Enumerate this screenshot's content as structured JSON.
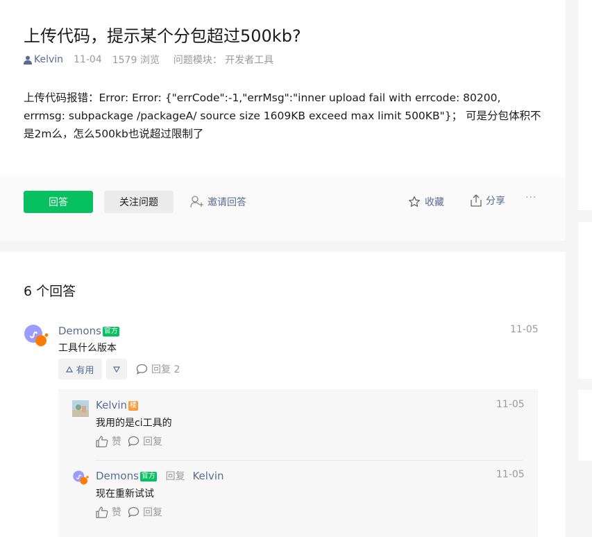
{
  "question": {
    "title": "上传代码，提示某个分包超过500kb?",
    "author": "Kelvin",
    "date": "11-04",
    "views": "1579 浏览",
    "module": "问题模块：  开发者工具",
    "body": "上传代码报错：Error: Error: {\"errCode\":-1,\"errMsg\":\"inner upload fail with errcode: 80200, errmsg: subpackage /packageA/ source size 1609KB exceed max limit 500KB\"}；  可是分包体积不是2m么，怎么500kb也说超过限制了"
  },
  "actions": {
    "answer": "回答",
    "follow": "关注问题",
    "invite": "邀请回答",
    "collect": "收藏",
    "share": "分享",
    "more": "···"
  },
  "answers": {
    "heading": "6 个回答",
    "first": {
      "user": "Demons",
      "badge": "官方",
      "date": "11-05",
      "text": "工具什么版本",
      "useful": "有用",
      "reply": "回复 2"
    },
    "replies": [
      {
        "user": "Kelvin",
        "badge": "楼",
        "date": "11-05",
        "text": "我用的是ci工具的",
        "like": "赞",
        "reply": "回复"
      },
      {
        "user": "Demons",
        "badge": "官方",
        "reply_word": "回复",
        "reply_to": "Kelvin",
        "date": "11-05",
        "text": "现在重新试试",
        "like": "赞",
        "reply": "回复"
      }
    ]
  },
  "colors": {
    "brand_green": "#07c160",
    "link_blue": "#576b95",
    "op_orange": "#fa9d3b"
  },
  "icons": [
    "user-icon",
    "invite-icon",
    "star-icon",
    "share-icon",
    "miniprogram-avatar-icon",
    "thumb-up-icon",
    "comment-icon",
    "arrow-up-icon",
    "arrow-down-icon"
  ]
}
